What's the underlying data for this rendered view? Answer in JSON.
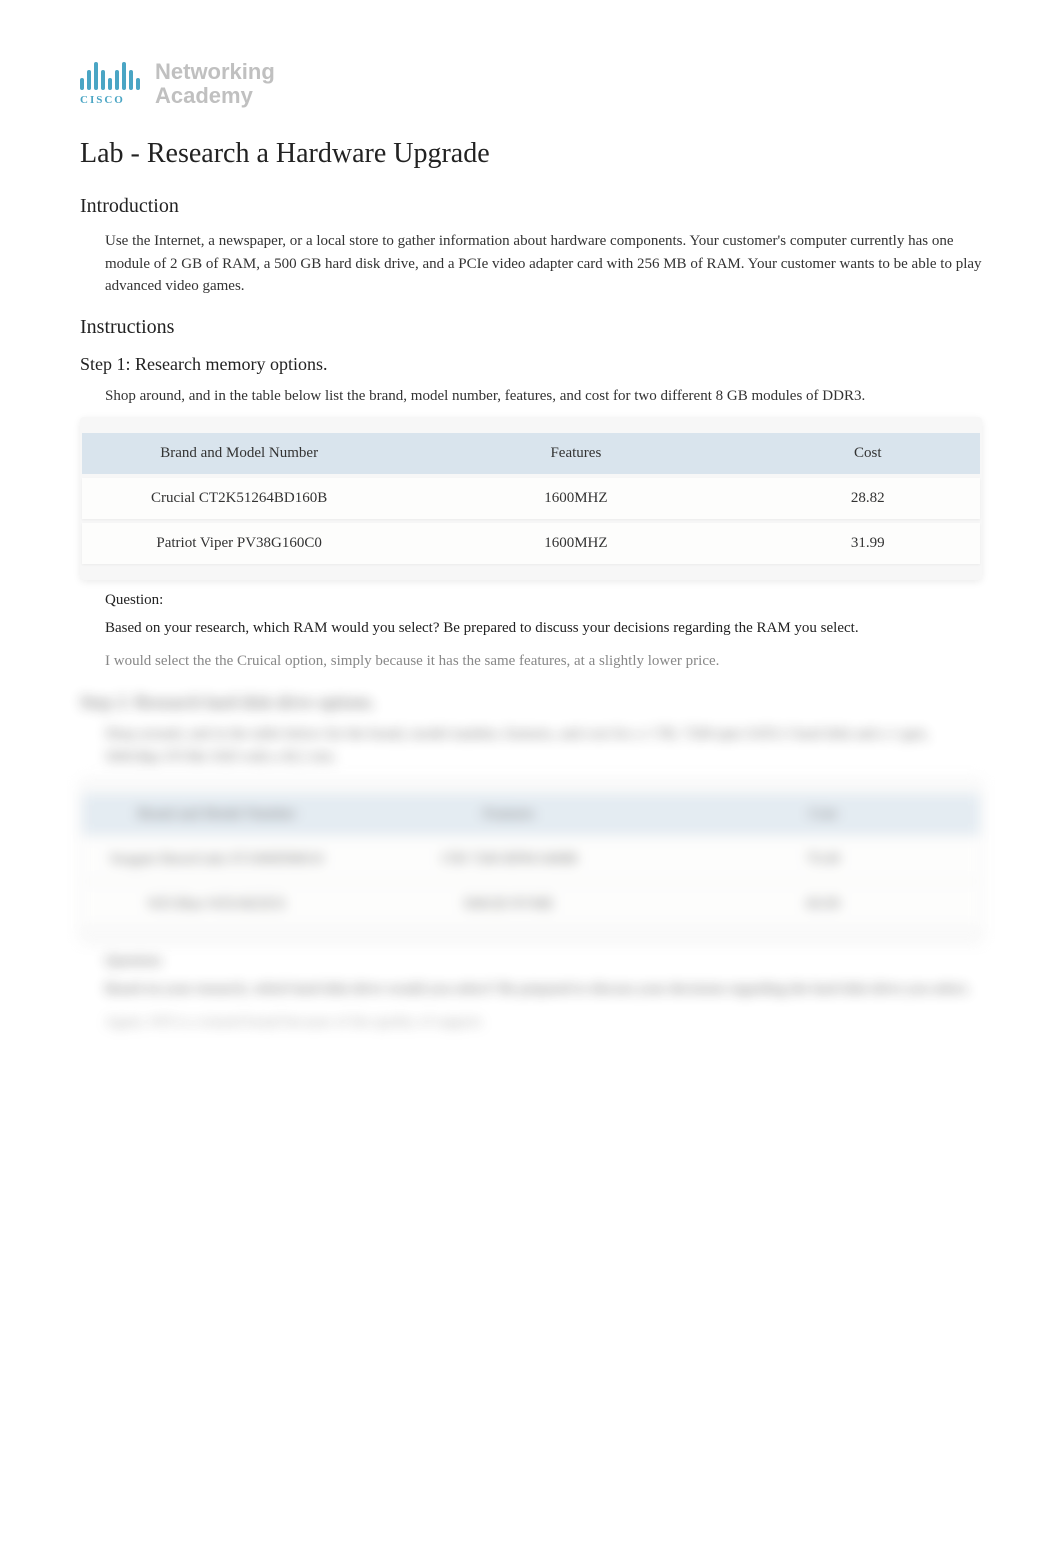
{
  "logo": {
    "brand_top": "Networking",
    "brand_bottom": "Academy",
    "cisco": "CISCO"
  },
  "title": "Lab - Research a Hardware Upgrade",
  "introduction": {
    "heading": "Introduction",
    "text": "Use the Internet, a newspaper, or a local store to gather information about hardware components. Your customer's computer currently has        one module of 2 GB of RAM, a 500 GB hard disk drive, and a PCIe video adapter card with 256 MB of RAM. Your customer wants to be able to play advanced video games."
  },
  "instructions": {
    "heading": "Instructions"
  },
  "step1": {
    "heading": "Step 1: Research memory options.",
    "text": "Shop around, and in the table below list the brand, model number, features, and cost for two different 8 GB modules of DDR3.",
    "table": {
      "headers": [
        "Brand and Model Number",
        "Features",
        "Cost"
      ],
      "rows": [
        [
          "Crucial CT2K51264BD160B",
          "1600MHZ",
          "28.82"
        ],
        [
          "Patriot Viper PV38G160C0",
          "1600MHZ",
          "31.99"
        ]
      ]
    },
    "question_label": "Question:",
    "question": "Based on your research, which RAM would you select? Be prepared to discuss your decisions regarding the RAM you select.",
    "answer": "I would select the the Cruical option, simply because it has the same features, at a slightly lower price."
  },
  "step2": {
    "heading": "Step 2: Research hard disk drive options.",
    "text": "Shop around, and in the table below list the brand, model number, features, and cost for a 1 TB, 7200-rpm SATA 3 hard disk and a 1-gen, 500GBps NVMe SSD with a M.2 slot.",
    "table": {
      "headers": [
        "Brand and Model Number",
        "Features",
        "Cost"
      ],
      "rows": [
        [
          "Seagate BarraCuda ST1000DM010",
          "1TB 7200 RPM 64MB",
          "79.49"
        ],
        [
          "WD Blue WD10EZEX",
          "500GB NVME",
          "69.99"
        ]
      ]
    },
    "question_label": "Question:",
    "question": "Based on your research, which hard disk drive would you select? Be prepared to discuss your decisions regarding the hard disk drive you select.",
    "answer": "Again, WD is a trusted brand because of the quality of support."
  }
}
